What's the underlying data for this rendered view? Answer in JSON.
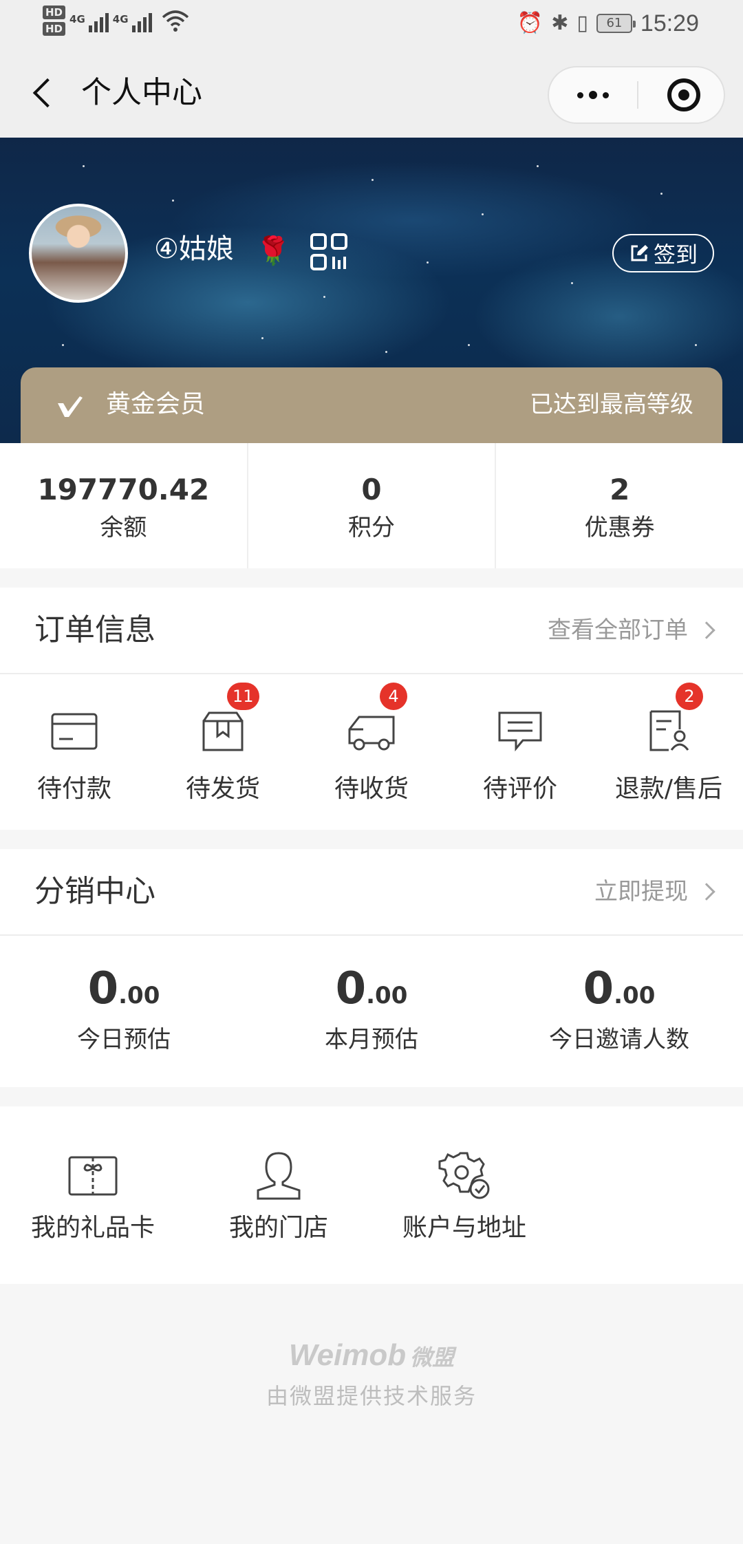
{
  "status_bar": {
    "hd1": "HD",
    "hd2": "HD",
    "net1": "4G",
    "net2": "4G",
    "battery": "61",
    "time": "15:29",
    "icons": [
      "alarm-icon",
      "bluetooth-icon",
      "vibrate-icon",
      "battery-icon",
      "wifi-icon",
      "signal-icon"
    ]
  },
  "nav": {
    "title": "个人中心",
    "back_icon": "back-arrow-icon",
    "more_icon": "more-dots-icon",
    "close_icon": "close-target-icon"
  },
  "profile": {
    "name": "④姑娘",
    "name_icon": "🌹",
    "signin_label": "签到",
    "member_level": "黄金会员",
    "member_note": "已达到最高等级"
  },
  "stats": [
    {
      "value": "197770.42",
      "label": "余额"
    },
    {
      "value": "0",
      "label": "积分"
    },
    {
      "value": "2",
      "label": "优惠券"
    }
  ],
  "orders": {
    "title": "订单信息",
    "link": "查看全部订单",
    "items": [
      {
        "label": "待付款",
        "icon": "card-icon",
        "badge": ""
      },
      {
        "label": "待发货",
        "icon": "package-icon",
        "badge": "11"
      },
      {
        "label": "待收货",
        "icon": "truck-icon",
        "badge": "4"
      },
      {
        "label": "待评价",
        "icon": "comment-icon",
        "badge": ""
      },
      {
        "label": "退款/售后",
        "icon": "refund-icon",
        "badge": "2"
      }
    ]
  },
  "distribution": {
    "title": "分销中心",
    "link": "立即提现",
    "items": [
      {
        "int": "0",
        "dec": ".00",
        "label": "今日预估"
      },
      {
        "int": "0",
        "dec": ".00",
        "label": "本月预估"
      },
      {
        "int": "0",
        "dec": ".00",
        "label": "今日邀请人数"
      }
    ]
  },
  "tools": [
    {
      "label": "我的礼品卡",
      "icon": "gift-card-icon"
    },
    {
      "label": "我的门店",
      "icon": "person-icon"
    },
    {
      "label": "账户与地址",
      "icon": "settings-check-icon"
    }
  ],
  "footer": {
    "logo": "Weimob",
    "logo_cn": "微盟",
    "text": "由微盟提供技术服务"
  },
  "colors": {
    "gold": "#ae9e82",
    "badge_red": "#e5332a",
    "banner_dark": "#0f2748"
  }
}
